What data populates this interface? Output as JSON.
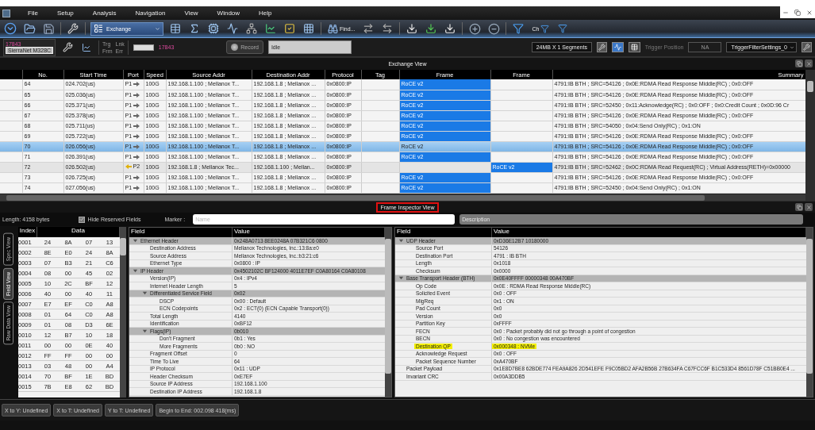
{
  "menu_bar": {
    "items": [
      "File",
      "Setup",
      "Analysis",
      "Navigation",
      "View",
      "Window",
      "Help"
    ]
  },
  "toolbar": {
    "view_selector": "Exchange",
    "find_button": "Find...",
    "channel_filter": "Ch"
  },
  "status_toolbar": {
    "port_count": "17843",
    "device": "SierraNet M328C",
    "counters": [
      "Trg",
      "Lnk",
      "Frm",
      "Err"
    ],
    "capture_count": "17843",
    "record_button": "Record",
    "state": "Idle",
    "buffer": "24MB X 1 Segments",
    "trigger_label": "Trigger Position",
    "trigger_position": "NA",
    "trigger_settings": "TriggerFilterSettings_0"
  },
  "exchange_view": {
    "title": "Exchange View",
    "columns": [
      "No.",
      "Start Time",
      "Port",
      "Speed",
      "Source Addr",
      "Destination Addr",
      "Protocol",
      "Tag",
      "Frame",
      "Frame",
      "Summary"
    ],
    "rows": [
      {
        "no": "64",
        "start_time": "024.702(us)",
        "port": "P1",
        "kind": "outbound",
        "speed": "100G",
        "source": "192.168.1.100 ; Mellanox T...",
        "destination": "192.168.1.8 ; Mellanox ...",
        "protocol": "0x0800:IP",
        "frame_1": "RoCE v2",
        "summary": "4791:IB BTH ; SRC=54126 ; 0x0E:RDMA Read Response Middle(RC) ; 0x0:OFF",
        "selected": false
      },
      {
        "no": "65",
        "start_time": "025.036(us)",
        "port": "P1",
        "kind": "outbound",
        "speed": "100G",
        "source": "192.168.1.100 ; Mellanox T...",
        "destination": "192.168.1.8 ; Mellanox ...",
        "protocol": "0x0800:IP",
        "frame_1": "RoCE v2",
        "summary": "4791:IB BTH ; SRC=54126 ; 0x0E:RDMA Read Response Middle(RC) ; 0x0:OFF",
        "selected": false
      },
      {
        "no": "66",
        "start_time": "025.371(us)",
        "port": "P1",
        "kind": "outbound",
        "speed": "100G",
        "source": "192.168.1.100 ; Mellanox T...",
        "destination": "192.168.1.8 ; Mellanox ...",
        "protocol": "0x0800:IP",
        "frame_1": "RoCE v2",
        "summary": "4791:IB BTH ; SRC=52450 ; 0x11:Acknowledge(RC) ; 0x0:OFF ; 0x0:Credit Count ; 0x0D:96 Cr",
        "selected": false
      },
      {
        "no": "67",
        "start_time": "025.378(us)",
        "port": "P1",
        "kind": "outbound",
        "speed": "100G",
        "source": "192.168.1.100 ; Mellanox T...",
        "destination": "192.168.1.8 ; Mellanox ...",
        "protocol": "0x0800:IP",
        "frame_1": "RoCE v2",
        "summary": "4791:IB BTH ; SRC=54126 ; 0x0E:RDMA Read Response Middle(RC) ; 0x0:OFF",
        "selected": false
      },
      {
        "no": "68",
        "start_time": "025.711(us)",
        "port": "P1",
        "kind": "outbound",
        "speed": "100G",
        "source": "192.168.1.100 ; Mellanox T...",
        "destination": "192.168.1.8 ; Mellanox ...",
        "protocol": "0x0800:IP",
        "frame_1": "RoCE v2",
        "summary": "4791:IB BTH ; SRC=54050 ; 0x04:Send Only(RC) ; 0x1:ON",
        "selected": false
      },
      {
        "no": "69",
        "start_time": "025.722(us)",
        "port": "P1",
        "kind": "outbound",
        "speed": "100G",
        "source": "192.168.1.100 ; Mellanox T...",
        "destination": "192.168.1.8 ; Mellanox ...",
        "protocol": "0x0800:IP",
        "frame_1": "RoCE v2",
        "summary": "4791:IB BTH ; SRC=54126 ; 0x0E:RDMA Read Response Middle(RC) ; 0x0:OFF",
        "selected": false
      },
      {
        "no": "70",
        "start_time": "026.056(us)",
        "port": "P1",
        "kind": "outbound",
        "speed": "100G",
        "source": "192.168.1.100 ; Mellanox T...",
        "destination": "192.168.1.8 ; Mellanox ...",
        "protocol": "0x0800:IP",
        "frame_1": "RoCE v2",
        "summary": "4791:IB BTH ; SRC=54126 ; 0x0E:RDMA Read Response Middle(RC) ; 0x0:OFF",
        "selected": true
      },
      {
        "no": "71",
        "start_time": "026.391(us)",
        "port": "P1",
        "kind": "outbound",
        "speed": "100G",
        "source": "192.168.1.100 ; Mellanox T...",
        "destination": "192.168.1.8 ; Mellanox ...",
        "protocol": "0x0800:IP",
        "frame_1": "RoCE v2",
        "summary": "4791:IB BTH ; SRC=54126 ; 0x0E:RDMA Read Response Middle(RC) ; 0x0:OFF",
        "selected": false
      },
      {
        "no": "72",
        "start_time": "026.502(us)",
        "port": "P2",
        "kind": "inbound",
        "speed": "100G",
        "source": "192.168.1.8 ; Mellanox Tec...",
        "destination": "192.168.1.100 ; Mellan...",
        "protocol": "0x0800:IP",
        "frame_2": "RoCE v2",
        "summary": "4791:IB BTH ; SRC=52462 ; 0x0C:RDMA Read Request(RC) ; Virtual Address(RETH)=0x00000",
        "selected": false
      },
      {
        "no": "73",
        "start_time": "026.725(us)",
        "port": "P1",
        "kind": "outbound",
        "speed": "100G",
        "source": "192.168.1.100 ; Mellanox T...",
        "destination": "192.168.1.8 ; Mellanox ...",
        "protocol": "0x0800:IP",
        "frame_1": "RoCE v2",
        "summary": "4791:IB BTH ; SRC=54126 ; 0x0E:RDMA Read Response Middle(RC) ; 0x0:OFF",
        "selected": false
      },
      {
        "no": "74",
        "start_time": "027.056(us)",
        "port": "P1",
        "kind": "outbound",
        "speed": "100G",
        "source": "192.168.1.100 ; Mellanox T...",
        "destination": "192.168.1.8 ; Mellanox ...",
        "protocol": "0x0800:IP",
        "frame_1": "RoCE v2",
        "summary": "4791:IB BTH ; SRC=52450 ; 0x04:Send Only(RC) ; 0x1:ON",
        "selected": false
      }
    ]
  },
  "frame_inspector": {
    "title": "Frame Inspector View",
    "annotated": true,
    "length": "Length: 4158 bytes",
    "hide_reserved": {
      "label": "Hide Reserved Fields",
      "checked": true
    },
    "marker_label": "Marker :",
    "name_placeholder": "Name",
    "description_placeholder": "Description",
    "views": [
      {
        "label": "Spec View",
        "selected": false
      },
      {
        "label": "Field View",
        "selected": true
      },
      {
        "label": "Raw Data View",
        "selected": false
      }
    ],
    "hex": {
      "columns": [
        "Index",
        "Data"
      ],
      "rows": [
        [
          "0001",
          "24",
          "8A",
          "07",
          "13"
        ],
        [
          "0002",
          "8E",
          "E0",
          "24",
          "8A"
        ],
        [
          "0003",
          "07",
          "B3",
          "21",
          "C6"
        ],
        [
          "0004",
          "08",
          "00",
          "45",
          "02"
        ],
        [
          "0005",
          "10",
          "2C",
          "BF",
          "12"
        ],
        [
          "0006",
          "40",
          "00",
          "40",
          "11"
        ],
        [
          "0007",
          "E7",
          "EF",
          "C0",
          "A8"
        ],
        [
          "0008",
          "01",
          "64",
          "C0",
          "A8"
        ],
        [
          "0009",
          "01",
          "08",
          "D3",
          "6E"
        ],
        [
          "0010",
          "12",
          "B7",
          "10",
          "18"
        ],
        [
          "0011",
          "00",
          "00",
          "0E",
          "40"
        ],
        [
          "0012",
          "FF",
          "FF",
          "00",
          "00"
        ],
        [
          "0013",
          "03",
          "48",
          "00",
          "A4"
        ],
        [
          "0014",
          "70",
          "BF",
          "1E",
          "BD"
        ],
        [
          "0015",
          "7B",
          "E8",
          "62",
          "BD"
        ]
      ]
    },
    "trees": [
      {
        "columns": [
          "Field",
          "Value"
        ],
        "nodes": [
          {
            "field": "Ethernet Header",
            "value": "0x248A0713 8EE0248A 07B321C6 0800",
            "expanded": true,
            "children": [
              {
                "field": "Destination Address",
                "value": "Mellanox Technologies, Inc.:13:8a:e0"
              },
              {
                "field": "Source Address",
                "value": "Mellanox Technologies, Inc.:b3:21:c6"
              },
              {
                "field": "Ethernet Type",
                "value": "0x0800 : IP"
              }
            ]
          },
          {
            "field": "IP Header",
            "value": "0x4502102C BF124000 4011E7EF C0A80164 C0A80108",
            "expanded": true,
            "children": [
              {
                "field": "Version(IP)",
                "value": "0x4 : IPv4"
              },
              {
                "field": "Internet Header Length",
                "value": "5"
              },
              {
                "field": "Differentiated Service Field",
                "value": "0x02",
                "expanded": true,
                "children": [
                  {
                    "field": "DSCP",
                    "value": "0x00 : Default"
                  },
                  {
                    "field": "ECN Codepoints",
                    "value": "0x2 : ECT(0) (ECN Capable Transport(0))"
                  }
                ]
              },
              {
                "field": "Total Length",
                "value": "4140"
              },
              {
                "field": "Identification",
                "value": "0xBF12"
              },
              {
                "field": "Flags(IP)",
                "value": "0b010",
                "expanded": true,
                "children": [
                  {
                    "field": "Don't Fragment",
                    "value": "0b1 : Yes"
                  },
                  {
                    "field": "More Fragments",
                    "value": "0b0 : NO"
                  }
                ]
              },
              {
                "field": "Fragment Offset",
                "value": "0"
              },
              {
                "field": "Time To Live",
                "value": "64"
              },
              {
                "field": "IP Protocol",
                "value": "0x11 : UDP"
              },
              {
                "field": "Header Checksum",
                "value": "0xE7EF"
              },
              {
                "field": "Source IP Address",
                "value": "192.168.1.100"
              },
              {
                "field": "Destination IP Address",
                "value": "192.168.1.8"
              }
            ]
          }
        ]
      },
      {
        "columns": [
          "Field",
          "Value"
        ],
        "nodes": [
          {
            "field": "UDP Header",
            "value": "0xD36E12B7 10180000",
            "expanded": true,
            "children": [
              {
                "field": "Source Port",
                "value": "54126"
              },
              {
                "field": "Destination Port",
                "value": "4791 : IB BTH"
              },
              {
                "field": "Length",
                "value": "0x1018"
              },
              {
                "field": "Checksum",
                "value": "0x0000"
              }
            ]
          },
          {
            "field": "Base Transport Header (BTH)",
            "value": "0x0E40FFFF 00000348 00A470BF",
            "expanded": true,
            "children": [
              {
                "field": "Op Code",
                "value": "0x0E : RDMA Read Response Middle(RC)"
              },
              {
                "field": "Solicited Event",
                "value": "0x0 : OFF"
              },
              {
                "field": "MigReq",
                "value": "0x1 : ON"
              },
              {
                "field": "Pad Count",
                "value": "0x0"
              },
              {
                "field": "Version",
                "value": "0x0"
              },
              {
                "field": "Partition Key",
                "value": "0xFFFF"
              },
              {
                "field": "FECN",
                "value": "0x0 : Packet probably did not go through a point of congestion"
              },
              {
                "field": "BECN",
                "value": "0x0 : No congestion was encountered"
              },
              {
                "field": "Destination QP",
                "value": "0x000348 : NVMe",
                "highlighted": true
              },
              {
                "field": "Acknowledge Request",
                "value": "0x0 : OFF"
              },
              {
                "field": "Packet Sequence Number",
                "value": "0xA470BF"
              }
            ]
          },
          {
            "field": "Packet Payload",
            "value": "0x1E8D7BE8 62BDE774 FEA9A826 2D541EFE F9C05BD2 AFA2B56B 27B634FA C67FCC6F B1C533D4 8561D78F C51BB0E4 ..."
          },
          {
            "field": "Invariant CRC",
            "value": "0x00A3DDB5"
          }
        ]
      }
    ]
  },
  "status_bar": [
    "X to Y: Undefined",
    "X to T: Undefined",
    "Y to T: Undefined",
    "Begin to End: 002.098 418(ms)"
  ]
}
